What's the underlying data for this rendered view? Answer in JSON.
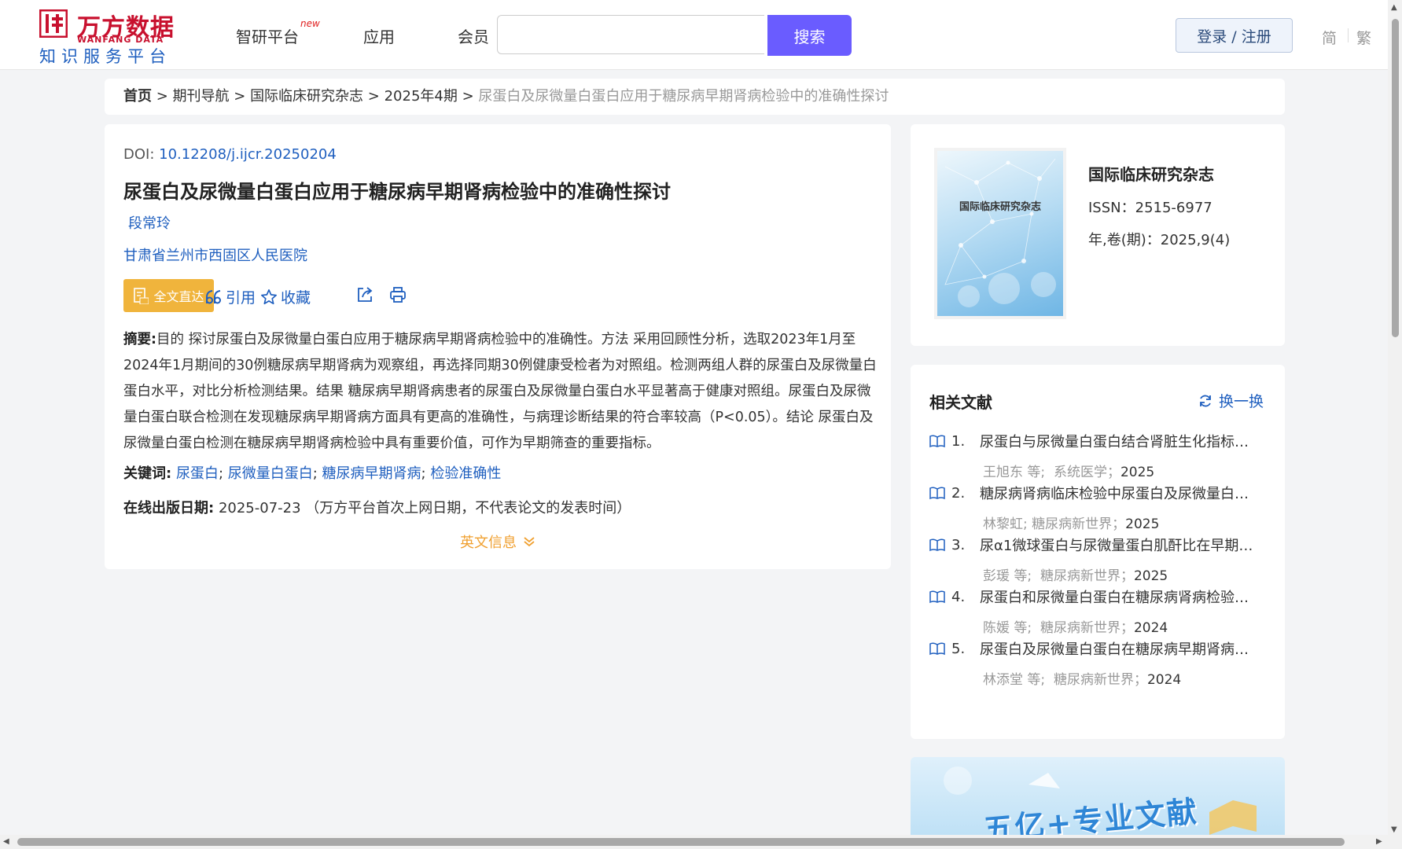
{
  "header": {
    "logo_cn": "万方数据",
    "logo_en": "WANFANG DATA",
    "logo_sub": "知识服务平台",
    "nav": [
      {
        "label": "智研平台",
        "badge": "new"
      },
      {
        "label": "应用"
      },
      {
        "label": "会员"
      }
    ],
    "search_value": "",
    "search_button": "搜索",
    "login_button": "登录 / 注册",
    "lang_simplified": "简",
    "lang_traditional": "繁"
  },
  "breadcrumb": {
    "items": [
      "首页",
      "期刊导航",
      "国际临床研究杂志",
      "2025年4期"
    ],
    "separator": " > ",
    "current": "尿蛋白及尿微量白蛋白应用于糖尿病早期肾病检验中的准确性探讨"
  },
  "article": {
    "doi_label": "DOI:",
    "doi": "10.12208/j.ijcr.20250204",
    "title": "尿蛋白及尿微量白蛋白应用于糖尿病早期肾病检验中的准确性探讨",
    "author": "段常玲",
    "affiliation": "甘肃省兰州市西固区人民医院",
    "actions": {
      "fulltext": "全文直达",
      "cite": "引用",
      "favorite": "收藏"
    },
    "abstract_label": "摘要:",
    "abstract": "目的 探讨尿蛋白及尿微量白蛋白应用于糖尿病早期肾病检验中的准确性。方法 采用回顾性分析，选取2023年1月至2024年1月期间的30例糖尿病早期肾病为观察组，再选择同期30例健康受检者为对照组。检测两组人群的尿蛋白及尿微量白蛋白水平，对比分析检测结果。结果 糖尿病早期肾病患者的尿蛋白及尿微量白蛋白水平显著高于健康对照组。尿蛋白及尿微量白蛋白联合检测在发现糖尿病早期肾病方面具有更高的准确性，与病理诊断结果的符合率较高（P<0.05）。结论 尿蛋白及尿微量白蛋白检测在糖尿病早期肾病检验中具有重要价值，可作为早期筛查的重要指标。",
    "keywords_label": "关键词:",
    "keywords": [
      "尿蛋白",
      "尿微量白蛋白",
      "糖尿病早期肾病",
      "检验准确性"
    ],
    "pubdate_label": "在线出版日期:",
    "pubdate": "2025-07-23",
    "pubdate_note": "（万方平台首次上网日期，不代表论文的发表时间）",
    "english_info": "英文信息"
  },
  "journal": {
    "cover_title": "国际临床研究杂志",
    "name": "国际临床研究杂志",
    "issn": "ISSN：2515-6977",
    "volume": "年,卷(期)：2025,9(4)"
  },
  "related": {
    "heading": "相关文献",
    "refresh": "换一换",
    "items": [
      {
        "num": "1.",
        "title": "尿蛋白与尿微量白蛋白结合肾脏生化指标在...",
        "authors": "王旭东  等;",
        "source": "系统医学；",
        "year": "2025"
      },
      {
        "num": "2.",
        "title": "糖尿病肾病临床检验中尿蛋白及尿微量白蛋...",
        "authors": "林黎虹;",
        "source": "糖尿病新世界；",
        "year": "2025"
      },
      {
        "num": "3.",
        "title": "尿α1微球蛋白与尿微量蛋白肌酐比在早期糖...",
        "authors": "彭瑗  等;",
        "source": "糖尿病新世界；",
        "year": "2025"
      },
      {
        "num": "4.",
        "title": "尿蛋白和尿微量白蛋白在糖尿病肾病检验中...",
        "authors": "陈媛  等;",
        "source": "糖尿病新世界；",
        "year": "2024"
      },
      {
        "num": "5.",
        "title": "尿蛋白及尿微量白蛋白在糖尿病早期肾病中...",
        "authors": "林添堂  等;",
        "source": "糖尿病新世界；",
        "year": "2024"
      }
    ]
  },
  "banner": {
    "text": "五亿+专业文献"
  }
}
